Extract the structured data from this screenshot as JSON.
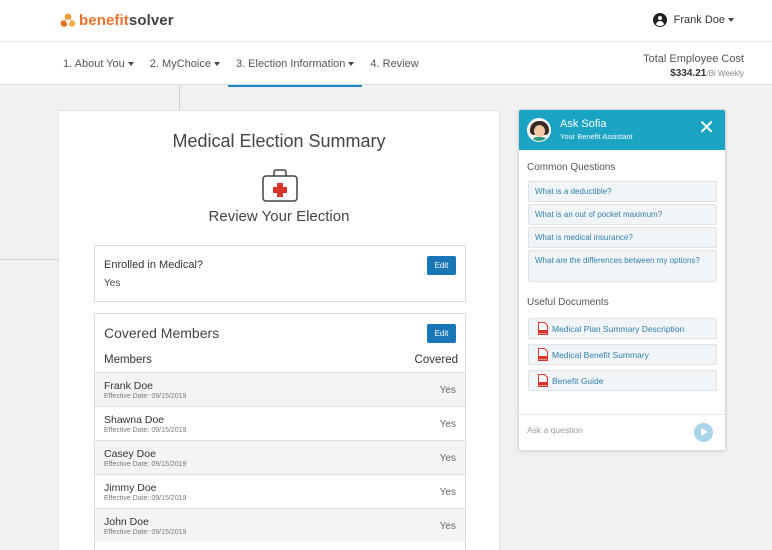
{
  "header": {
    "brand_part1": "benefit",
    "brand_part2": "solver",
    "user_name": "Frank Doe"
  },
  "nav": {
    "tabs": [
      {
        "label": "1. About You",
        "dropdown": true
      },
      {
        "label": "2. MyChoice",
        "dropdown": true
      },
      {
        "label": "3. Election Information",
        "dropdown": true,
        "active": true
      },
      {
        "label": "4. Review",
        "dropdown": false
      }
    ],
    "cost_label": "Total Employee Cost",
    "cost_amount": "$334.21",
    "cost_period": "/Bi Weekly"
  },
  "main": {
    "title": "Medical Election Summary",
    "subtitle": "Review Your Election",
    "enrolled_question": "Enrolled in Medical?",
    "enrolled_answer": "Yes",
    "edit_label": "Edit",
    "covered_heading": "Covered Members",
    "col_members": "Members",
    "col_covered": "Covered",
    "members": [
      {
        "name": "Frank Doe",
        "effective": "Effective Date: 09/15/2019",
        "covered": "Yes"
      },
      {
        "name": "Shawna Doe",
        "effective": "Effective Date: 09/15/2019",
        "covered": "Yes"
      },
      {
        "name": "Casey Doe",
        "effective": "Effective Date: 09/15/2019",
        "covered": "Yes"
      },
      {
        "name": "Jimmy Doe",
        "effective": "Effective Date: 09/15/2019",
        "covered": "Yes"
      },
      {
        "name": "John Doe",
        "effective": "Effective Date: 09/15/2019",
        "covered": "Yes"
      }
    ]
  },
  "chat": {
    "name": "Ask Sofia",
    "subtitle": "Your Benefit Assistant",
    "common_heading": "Common Questions",
    "questions": [
      "What is a deductible?",
      "What is an out of pocket maximum?",
      "What is medical insurance?",
      "What are the differences between my options?"
    ],
    "docs_heading": "Useful Documents",
    "documents": [
      "Medical Plan Summary Description",
      "Medical Benefit Summary",
      "Benefit Guide"
    ],
    "input_placeholder": "Ask a question",
    "accent_color": "#1aa3c3"
  },
  "colors": {
    "brand_orange": "#e8732a",
    "button_blue": "#1976b7",
    "active_tab_underline": "#1c86c5",
    "pdf_red": "#d9342b"
  }
}
